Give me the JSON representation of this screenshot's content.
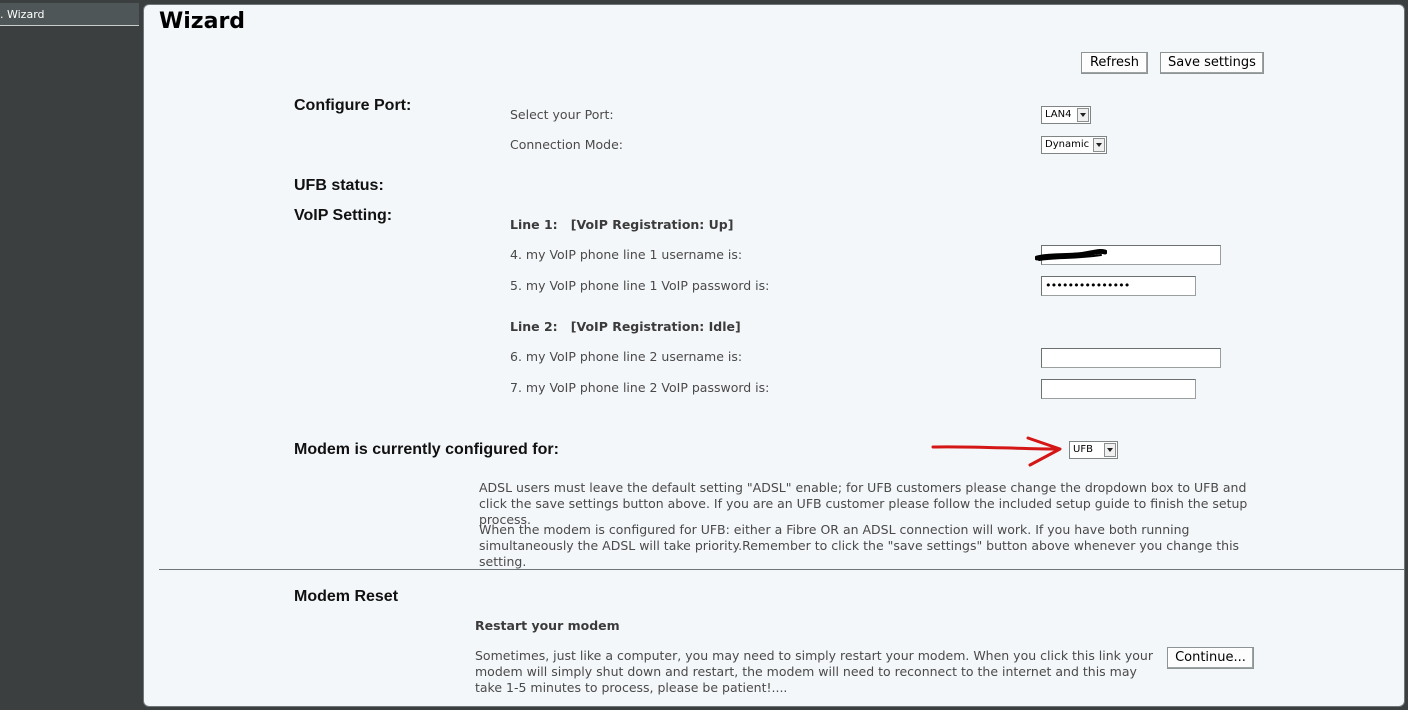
{
  "sidebar": {
    "items": [
      {
        "label": ". Wizard"
      }
    ]
  },
  "page": {
    "title": "Wizard"
  },
  "toolbar": {
    "refresh_label": "Refresh",
    "save_label": "Save settings"
  },
  "configure_port": {
    "heading": "Configure Port:",
    "port_label": "Select your Port:",
    "port_value": "LAN4",
    "mode_label": "Connection Mode:",
    "mode_value": "Dynamic"
  },
  "ufb_status": {
    "heading": "UFB status:"
  },
  "voip": {
    "heading": "VoIP Setting:",
    "line1": {
      "title": "Line 1:",
      "status": "[VoIP Registration: Up]",
      "username_label": "4. my VoIP phone line 1 username is:",
      "username_value": "",
      "password_label": "5. my VoIP phone line 1 VoIP password is:",
      "password_value": "•••••••••••••••"
    },
    "line2": {
      "title": "Line 2:",
      "status": "[VoIP Registration: Idle]",
      "username_label": "6. my VoIP phone line 2 username is:",
      "username_value": "",
      "password_label": "7. my VoIP phone line 2 VoIP password is:",
      "password_value": ""
    }
  },
  "modem_config": {
    "heading": "Modem is currently configured for:",
    "value": "UFB",
    "para1": "ADSL users must leave the default setting \"ADSL\" enable; for UFB customers please change the dropdown box to UFB and click the save settings button above. If you are an UFB customer please follow the included setup guide to finish the setup process.",
    "para2": "When the modem is configured for UFB: either a Fibre OR an ADSL connection will work. If you have both running simultaneously the ADSL will take priority.Remember to click the \"save settings\" button above whenever you change this setting."
  },
  "modem_reset": {
    "heading": "Modem Reset",
    "subheading": "Restart your modem",
    "para": "Sometimes, just like a computer, you may need to simply restart your modem. When you click this link your modem will simply shut down and restart, the modem will need to reconnect to the internet and this may take 1-5 minutes to process, please be patient!....",
    "continue_label": "Continue..."
  },
  "colors": {
    "annotation_arrow": "#d41616",
    "sidebar_bg": "#3b3f3f",
    "panel_bg": "#f4f7f9"
  }
}
